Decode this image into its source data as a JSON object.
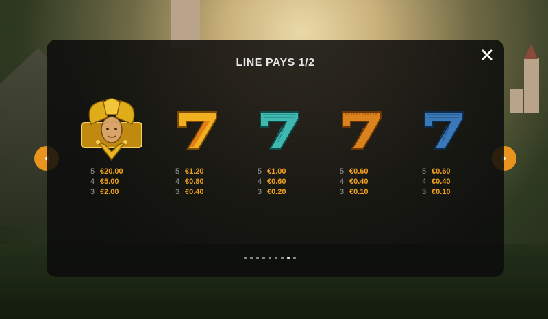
{
  "header": {
    "title": "LINE PAYS 1/2"
  },
  "controls": {
    "close_icon": "close-icon",
    "prev_icon": "chevron-left-icon",
    "next_icon": "chevron-right-icon"
  },
  "symbols": [
    {
      "name": "jester",
      "color": "#d9a416",
      "pays": [
        {
          "count": "5",
          "value": "€20.00"
        },
        {
          "count": "4",
          "value": "€5.00"
        },
        {
          "count": "3",
          "value": "€2.00"
        }
      ]
    },
    {
      "name": "seven-gold",
      "color": "#f0b020",
      "pays": [
        {
          "count": "5",
          "value": "€1.20"
        },
        {
          "count": "4",
          "value": "€0.80"
        },
        {
          "count": "3",
          "value": "€0.40"
        }
      ]
    },
    {
      "name": "seven-teal",
      "color": "#3fb8b0",
      "pays": [
        {
          "count": "5",
          "value": "€1.00"
        },
        {
          "count": "4",
          "value": "€0.60"
        },
        {
          "count": "3",
          "value": "€0.20"
        }
      ]
    },
    {
      "name": "seven-orange",
      "color": "#d9821e",
      "pays": [
        {
          "count": "5",
          "value": "€0.60"
        },
        {
          "count": "4",
          "value": "€0.40"
        },
        {
          "count": "3",
          "value": "€0.10"
        }
      ]
    },
    {
      "name": "seven-blue",
      "color": "#3a78b8",
      "pays": [
        {
          "count": "5",
          "value": "€0.60"
        },
        {
          "count": "4",
          "value": "€0.40"
        },
        {
          "count": "3",
          "value": "€0.10"
        }
      ]
    }
  ],
  "pagination": {
    "total": 9,
    "active_index": 7
  },
  "colors": {
    "accent": "#e8941f",
    "pay_value": "#f0a020"
  }
}
